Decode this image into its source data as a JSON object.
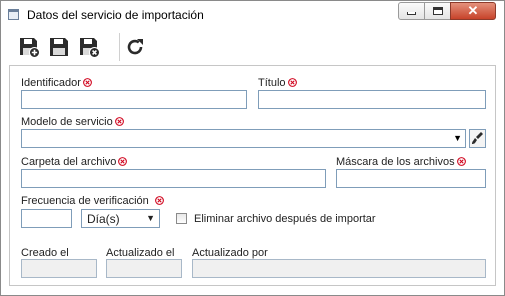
{
  "window": {
    "title": "Datos del servicio de importación"
  },
  "toolbar": {
    "buttons": [
      {
        "name": "save-new",
        "icon": "floppy-plus-icon"
      },
      {
        "name": "save",
        "icon": "floppy-icon"
      },
      {
        "name": "save-close",
        "icon": "floppy-close-icon"
      },
      {
        "name": "refresh",
        "icon": "refresh-icon"
      }
    ]
  },
  "form": {
    "identificador_label": "Identificador",
    "identificador_value": "",
    "titulo_label": "Título",
    "titulo_value": "",
    "modelo_label": "Modelo de servicio",
    "modelo_value": "",
    "carpeta_label": "Carpeta del archivo",
    "carpeta_value": "",
    "mascara_label": "Máscara de los archivos",
    "mascara_value": "",
    "frecuencia_label": "Frecuencia de verificación",
    "frecuencia_value": "",
    "frecuencia_unit": "Día(s)",
    "eliminar_label": "Eliminar archivo después de importar",
    "eliminar_checked": false,
    "creado_label": "Creado el",
    "creado_value": "",
    "actualizado_label": "Actualizado el",
    "actualizado_value": "",
    "actualizado_por_label": "Actualizado por",
    "actualizado_por_value": ""
  },
  "colors": {
    "required": "#d0021b",
    "input_border": "#7f9db9",
    "close_button": "#c7432a"
  }
}
